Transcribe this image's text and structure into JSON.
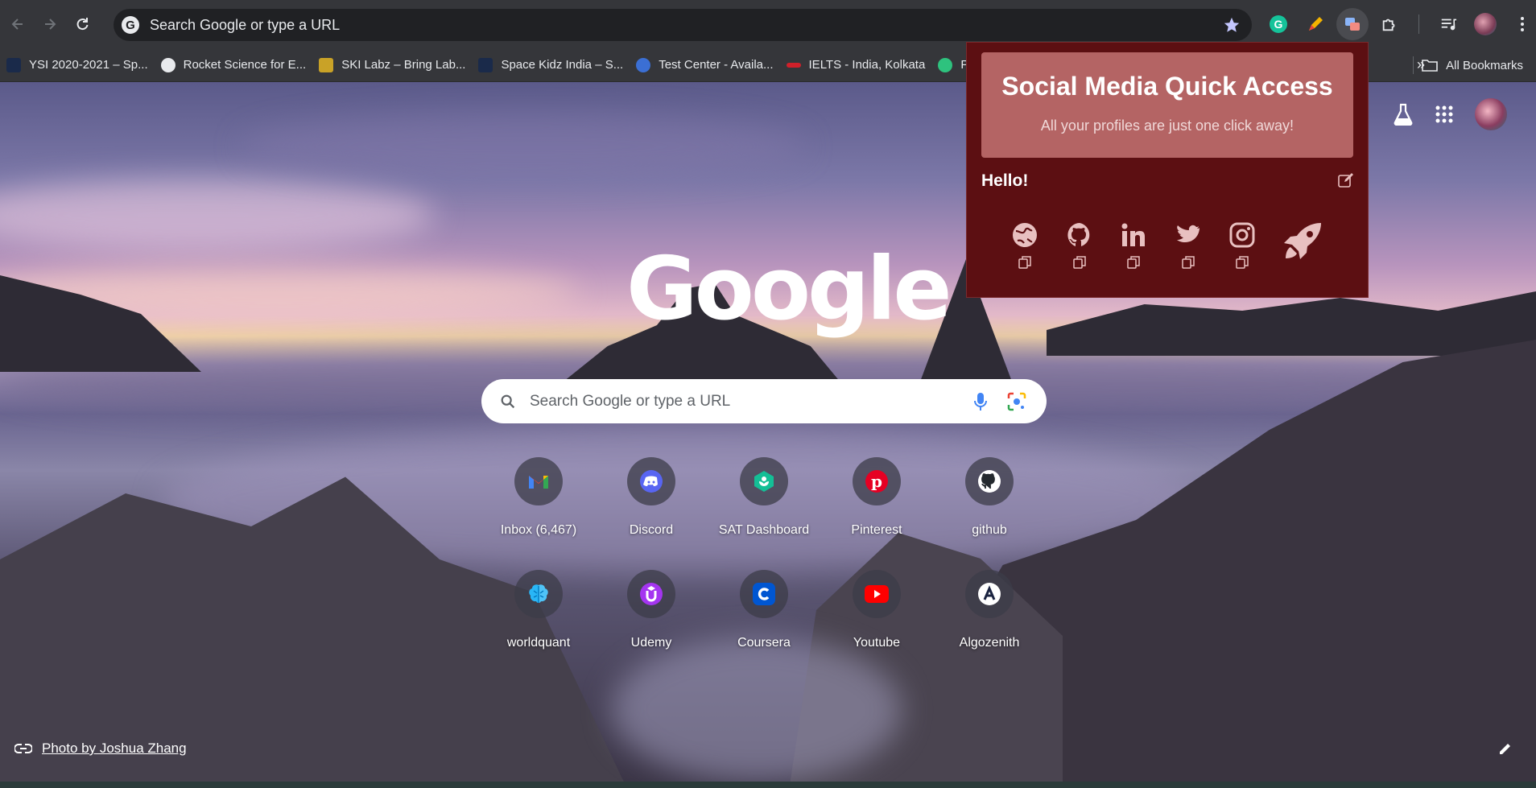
{
  "toolbar": {
    "omnibox_text": "Search Google or type a URL",
    "extensions": [
      "grammarly-icon",
      "highlighter-icon",
      "social-media-quick-access-icon",
      "puzzle-icon"
    ],
    "menu": "more-vert-icon"
  },
  "bookmarks": {
    "items": [
      {
        "label": "YSI 2020-2021 – Sp...",
        "color": "#1a2a4a"
      },
      {
        "label": "Rocket Science for E...",
        "color": "#e8eaed"
      },
      {
        "label": "SKI Labz – Bring Lab...",
        "color": "#c9a227"
      },
      {
        "label": "Space Kidz India – S...",
        "color": "#1a2a4a"
      },
      {
        "label": "Test Center - Availa...",
        "color": "#3b6fd4"
      },
      {
        "label": "IELTS - India, Kolkata",
        "color": "#d0202a"
      },
      {
        "label": "Pract",
        "color": "#2ec27e"
      }
    ],
    "all_label": "All Bookmarks"
  },
  "search": {
    "placeholder": "Search Google or type a URL"
  },
  "logo_text": "Google",
  "shortcuts": [
    {
      "label": "Inbox (6,467)",
      "icon": "gmail-icon"
    },
    {
      "label": "Discord",
      "icon": "discord-icon"
    },
    {
      "label": "SAT Dashboard",
      "icon": "khan-academy-icon"
    },
    {
      "label": "Pinterest",
      "icon": "pinterest-icon"
    },
    {
      "label": "github",
      "icon": "github-icon"
    },
    {
      "label": "worldquant",
      "icon": "brain-icon"
    },
    {
      "label": "Udemy",
      "icon": "udemy-icon"
    },
    {
      "label": "Coursera",
      "icon": "coursera-icon"
    },
    {
      "label": "Youtube",
      "icon": "youtube-icon"
    },
    {
      "label": "Algozenith",
      "icon": "algozenith-icon"
    }
  ],
  "credit": {
    "text": "Photo by Joshua Zhang"
  },
  "popup": {
    "title": "Social Media Quick Access",
    "subtitle": "All your profiles are just one click away!",
    "greeting": "Hello!",
    "socials": [
      "globe-icon",
      "github-icon",
      "linkedin-icon",
      "twitter-icon",
      "instagram-icon"
    ],
    "colors": {
      "background": "#5c0f12",
      "header": "#b46464"
    }
  }
}
